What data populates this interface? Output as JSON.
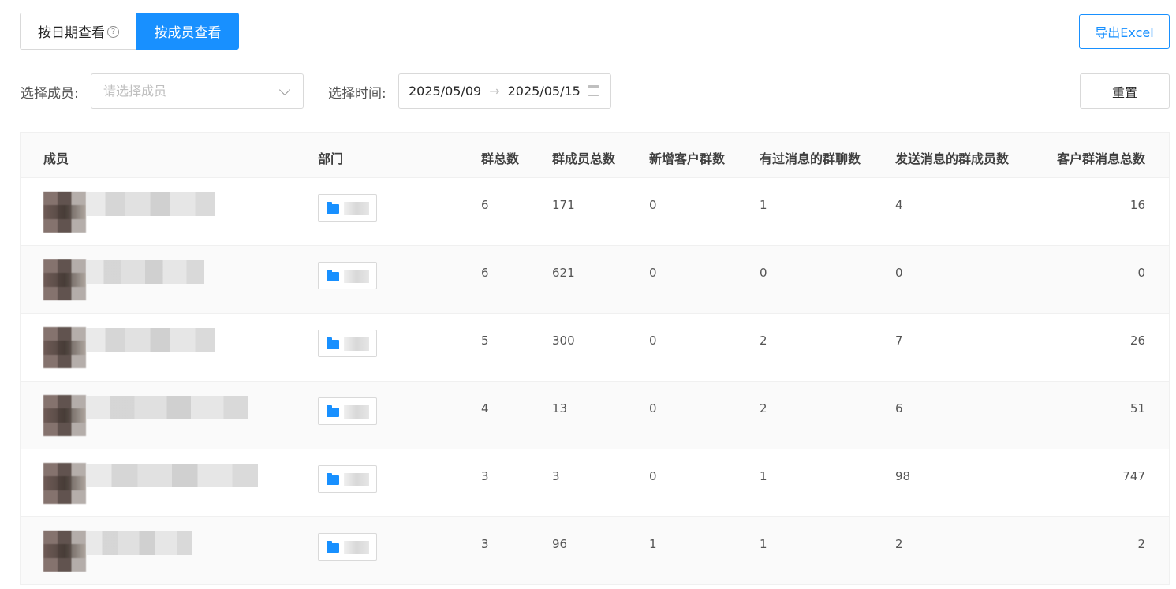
{
  "toggle": {
    "by_date_label": "按日期查看",
    "by_member_label": "按成员查看"
  },
  "toolbar": {
    "export_label": "导出Excel",
    "reset_label": "重置"
  },
  "filters": {
    "member_label": "选择成员:",
    "member_placeholder": "请选择成员",
    "time_label": "选择时间:",
    "start_date": "2025/05/09",
    "end_date": "2025/05/15"
  },
  "table": {
    "headers": [
      "成员",
      "部门",
      "群总数",
      "群成员总数",
      "新增客户群数",
      "有过消息的群聊数",
      "发送消息的群成员数",
      "客户群消息总数"
    ],
    "rows": [
      {
        "groups": "6",
        "members": "171",
        "new_groups": "0",
        "active_groups": "1",
        "senders": "4",
        "messages": "16"
      },
      {
        "groups": "6",
        "members": "621",
        "new_groups": "0",
        "active_groups": "0",
        "senders": "0",
        "messages": "0"
      },
      {
        "groups": "5",
        "members": "300",
        "new_groups": "0",
        "active_groups": "2",
        "senders": "7",
        "messages": "26"
      },
      {
        "groups": "4",
        "members": "13",
        "new_groups": "0",
        "active_groups": "2",
        "senders": "6",
        "messages": "51"
      },
      {
        "groups": "3",
        "members": "3",
        "new_groups": "0",
        "active_groups": "1",
        "senders": "98",
        "messages": "747"
      },
      {
        "groups": "3",
        "members": "96",
        "new_groups": "1",
        "active_groups": "1",
        "senders": "2",
        "messages": "2"
      }
    ]
  },
  "icons": {
    "help": "question-circle-icon",
    "select_arrow": "chevron-down-icon",
    "calendar": "calendar-icon",
    "folder": "folder-icon"
  },
  "colors": {
    "primary": "#1890ff",
    "header_bg": "#fafafa",
    "border": "#d9d9d9"
  }
}
